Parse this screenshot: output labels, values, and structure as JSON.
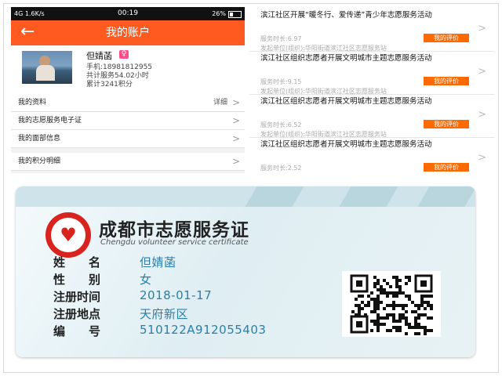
{
  "status_bar": {
    "signal": "4G",
    "speed": "1.6K/s",
    "time": "00:19",
    "battery": "26%"
  },
  "header": {
    "back": "←",
    "title": "我的账户"
  },
  "profile": {
    "name": "但婧菡",
    "gender_badge": "♀",
    "phone": "手机:18981812955",
    "hours": "共计服务54.02小时",
    "points": "累计3241积分"
  },
  "menu": [
    {
      "label": "我的资料",
      "detail": "详细"
    },
    {
      "label": "我的志愿服务电子证"
    },
    {
      "label": "我的面部信息"
    },
    {
      "label": "我的积分明细"
    }
  ],
  "activities": [
    {
      "title": "滨江社区开展“暖冬行、爱传递”青少年志愿服务活动",
      "duration": "服务时长:6.97",
      "org": "发起单位(组织):华阳街道滨江社区志愿服务站",
      "button": "我的评价"
    },
    {
      "title": "滨江社区组织志愿者开展文明城市主题志愿服务活动",
      "duration": "服务时长:9.15",
      "org": "发起单位(组织):华阳街道滨江社区志愿服务站",
      "button": "我的评价"
    },
    {
      "title": "滨江社区组织志愿者开展文明城市主题志愿服务活动",
      "duration": "服务时长:6.52",
      "org": "发起单位(组织):华阳街道滨江社区志愿服务站",
      "button": "我的评价"
    },
    {
      "title": "滨江社区组织志愿者开展文明城市主题志愿服务活动",
      "duration": "服务时长:2.52",
      "org": "",
      "button": "我的评价"
    }
  ],
  "card": {
    "title": "成都市志愿服务证",
    "subtitle": "Chengdu volunteer service certificate",
    "fields": [
      {
        "label": "姓　　名",
        "value": "但婧菡"
      },
      {
        "label": "性　　别",
        "value": "女"
      },
      {
        "label": "注册时间",
        "value": "2018-01-17"
      },
      {
        "label": "注册地点",
        "value": "天府新区"
      },
      {
        "label": "编　　号",
        "value": "510122A912055403"
      }
    ]
  },
  "colors": {
    "accent": "#ff5a1f",
    "button": "#ff6a00",
    "card_value": "#2a7ea8",
    "logo_red": "#d9231f"
  },
  "icons": {
    "back": "arrow-left-icon",
    "chevron": "chevron-right-icon",
    "qr": "qr-code-icon"
  }
}
